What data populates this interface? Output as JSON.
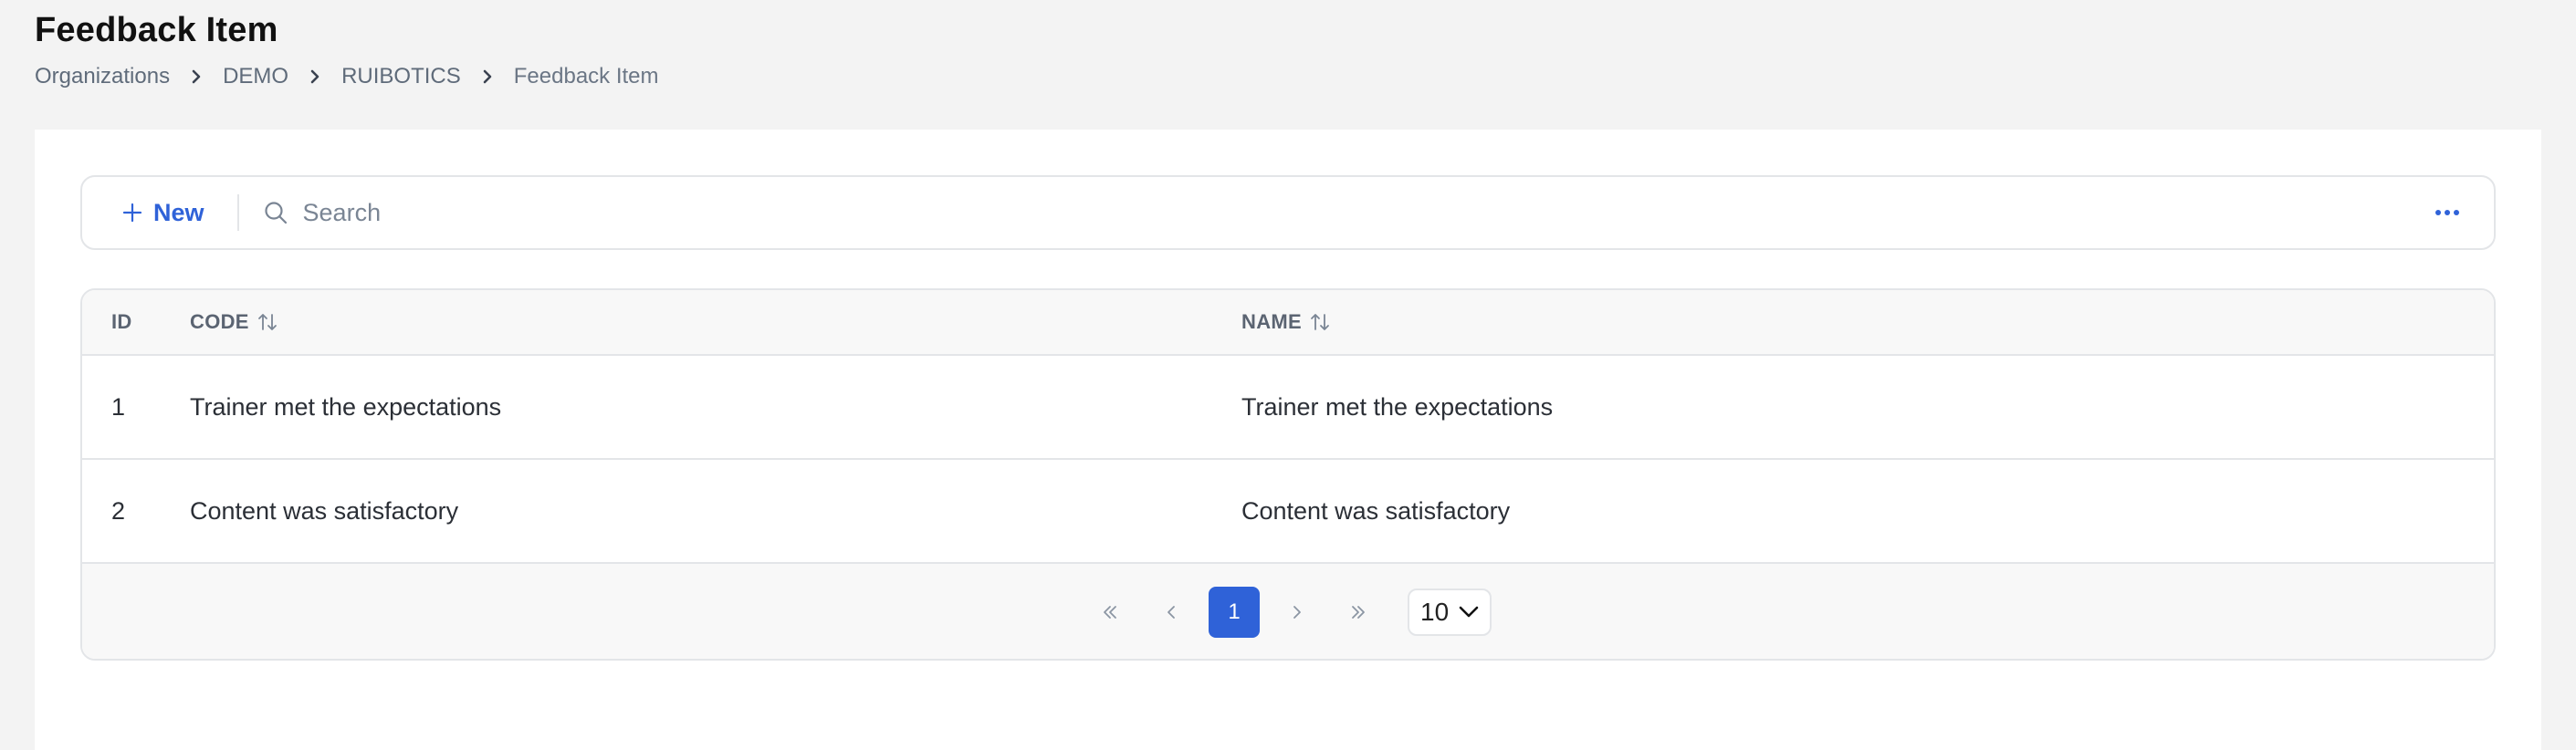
{
  "page": {
    "title": "Feedback Item"
  },
  "breadcrumb": {
    "items": [
      "Organizations",
      "DEMO",
      "RUIBOTICS",
      "Feedback Item"
    ]
  },
  "toolbar": {
    "new_label": "New",
    "search_placeholder": "Search",
    "more_icon": "ellipsis-horizontal-icon"
  },
  "table": {
    "columns": {
      "id": "ID",
      "code": "CODE",
      "name": "NAME"
    },
    "rows": [
      {
        "id": "1",
        "code": "Trainer met the expectations",
        "name": "Trainer met the expectations"
      },
      {
        "id": "2",
        "code": "Content was satisfactory",
        "name": "Content was satisfactory"
      }
    ]
  },
  "pagination": {
    "current_page": "1",
    "page_size": "10"
  },
  "colors": {
    "accent": "#2f62d8",
    "background": "#f3f3f3",
    "border": "#e3e5e8"
  }
}
